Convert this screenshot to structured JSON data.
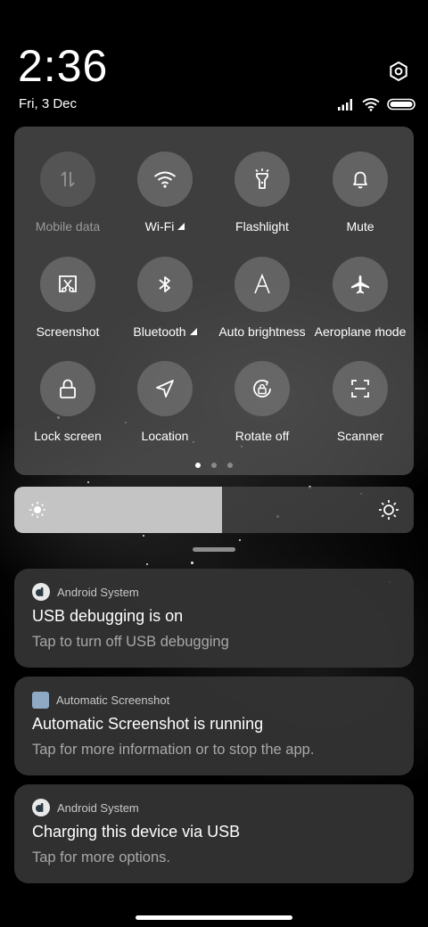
{
  "status": {
    "time": "2:36",
    "date": "Fri, 3 Dec",
    "icons": [
      "signal-icon",
      "wifi-icon",
      "battery-icon"
    ]
  },
  "quick_settings": {
    "tiles": [
      {
        "label": "Mobile data",
        "icon": "mobile-data-icon",
        "active": false
      },
      {
        "label": "Wi-Fi",
        "icon": "wifi-icon",
        "active": true
      },
      {
        "label": "Flashlight",
        "icon": "flashlight-icon",
        "active": true
      },
      {
        "label": "Mute",
        "icon": "bell-icon",
        "active": true
      },
      {
        "label": "Screenshot",
        "icon": "screenshot-icon",
        "active": true
      },
      {
        "label": "Bluetooth",
        "icon": "bluetooth-icon",
        "active": true
      },
      {
        "label": "Auto brightness",
        "icon": "auto-brightness-icon",
        "active": true
      },
      {
        "label": "Aeroplane mode",
        "icon": "airplane-icon",
        "active": true
      },
      {
        "label": "Lock screen",
        "icon": "lock-icon",
        "active": true
      },
      {
        "label": "Location",
        "icon": "location-icon",
        "active": true
      },
      {
        "label": "Rotate off",
        "icon": "rotate-lock-icon",
        "active": true
      },
      {
        "label": "Scanner",
        "icon": "scanner-icon",
        "active": true
      }
    ],
    "pages": 3,
    "current_page": 1
  },
  "brightness": {
    "level": 0.52
  },
  "notifications": [
    {
      "app": "Android System",
      "app_icon": "android-system-icon",
      "title": "USB debugging is on",
      "text": "Tap to turn off USB debugging"
    },
    {
      "app": "Automatic Screenshot",
      "app_icon": "automatic-screenshot-icon",
      "title": "Automatic Screenshot is running",
      "text": "Tap for more information or to stop the app."
    },
    {
      "app": "Android System",
      "app_icon": "android-system-icon",
      "title": "Charging this device via USB",
      "text": "Tap for more options."
    }
  ],
  "colors": {
    "panel": "#565656",
    "tile_circle": "#828282",
    "brightness_fill": "#c4c4c4",
    "notification_bg": "#343434"
  }
}
